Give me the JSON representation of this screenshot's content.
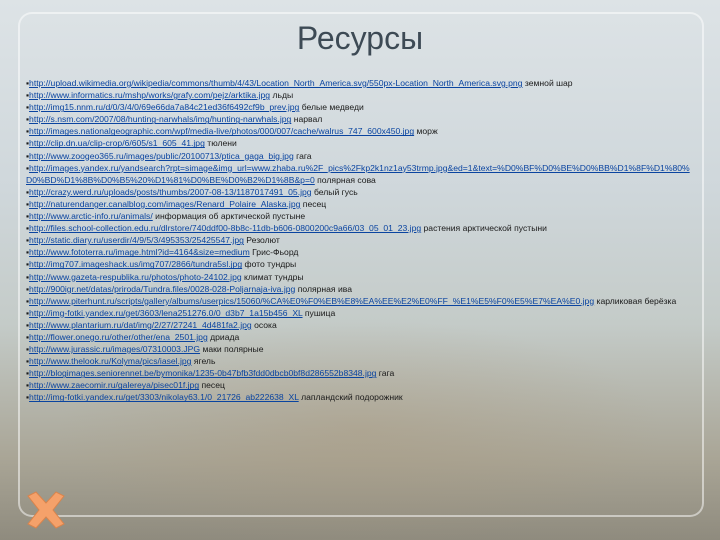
{
  "slide": {
    "title": "Ресурсы",
    "close_icon_color": "#f5a16a"
  },
  "items": [
    {
      "url": "http://upload.wikimedia.org/wikipedia/commons/thumb/4/43/Location_North_America.svg/550px-Location_North_America.svg.png",
      "text": " земной шар"
    },
    {
      "url": "http://www.informatics.ru/mshp/works/grafy.com/pejz/arktika.jpg",
      "text": " льды"
    },
    {
      "url": "http://img15.nnm.ru/d/0/3/4/0/69e66da7a84c21ed36f6492cf9b_prev.jpg",
      "text": "   белые медведи"
    },
    {
      "url": "http://s.nsm.com/2007/08/hunting-narwhals/img/hunting-narwhals.jpg",
      "text": "  нарвал"
    },
    {
      "url": "http://images.nationalgeographic.com/wpf/media-live/photos/000/007/cache/walrus_747_600x450.jpg",
      "text": " морж"
    },
    {
      "url": "http://clip.dn.ua/clip-crop/6/605/s1_605_41.jpg",
      "text": " тюлени"
    },
    {
      "url": "http://www.zoogeo365.ru/images/public/20100713/ptica_gaga_big.jpg",
      "text": " гага"
    },
    {
      "url": "http://images.yandex.ru/yandsearch?rpt=simage&img_url=www.zhaba.ru%2F_pics%2Fkp2k1nz1ay53trmp.jpg&ed=1&text=%D0%BF%D0%BE%D0%BB%D1%8F%D1%80%D0%BD%D1%8B%D0%B5%20%D1%81%D0%BE%D0%B2%D1%8B&p=0",
      "text": " полярная сова",
      "wrap": true
    },
    {
      "url": "http://crazy.werd.ru/uploads/posts/thumbs/2007-08-13/1187017491_05.jpg",
      "text": " белый гусь"
    },
    {
      "url": "http://naturendanger.canalblog.com/images/Renard_Polaire_Alaska.jpg",
      "text": " песец"
    },
    {
      "url": "http://www.arctic-info.ru/animals/",
      "text": " информация об арктической пустыне"
    },
    {
      "url": "http://files.school-collection.edu.ru/dlrstore/740ddf00-8b8c-11db-b606-0800200c9a66/03_05_01_23.jpg",
      "text": " растения арктической пустыни"
    },
    {
      "url": "http://static.diary.ru/userdir/4/9/5/3/495353/25425547.jpg",
      "text": " Резолют"
    },
    {
      "url": "http://www.fototerra.ru/image.html?id=4164&size=medium",
      "text": " Грис-Фьорд"
    },
    {
      "url": "http://img707.imageshack.us/img707/2866/tundra5sl.jpg",
      "text": " фото тундры"
    },
    {
      "url": "http://www.gazeta-respublika.ru/photos/photo-24102.jpg",
      "text": " климат тундры"
    },
    {
      "url": "http://900igr.net/datas/priroda/Tundra.files/0028-028-Poljarnaja-iva.jpg",
      "text": " полярная ива"
    },
    {
      "url": "http://www.piterhunt.ru/scripts/gallery/albums/userpics/15060/%CA%E0%F0%EB%E8%EA%EE%E2%E0%FF_%E1%E5%F0%E5%E7%EA%E0.jpg",
      "text": " карликовая берёзка",
      "wrap": true
    },
    {
      "url": "http://img-fotki.yandex.ru/get/3603/lena251276.0/0_d3b7_1a15b456_XL",
      "text": " пушица"
    },
    {
      "url": "http://www.plantarium.ru/dat/img/2/27/27241_4d481fa2.jpg",
      "text": " осока"
    },
    {
      "url": "http://flower.onego.ru/other/other/ena_2501.jpg",
      "text": " дриада"
    },
    {
      "url": "http://www.jurassic.ru/images/07310003.JPG",
      "text": " маки полярные"
    },
    {
      "url": "http://www.thelook.ru/Kolyma/pics/iasel.jpg",
      "text": " ягель"
    },
    {
      "url": "http://blogimages.seniorennet.be/bymonika/1235-0b47bfb3fdd0dbcb0bf8d286552b8348.jpg",
      "text": " гага"
    },
    {
      "url": "http://www.zaecomir.ru/galereya/pisec01f.jpg",
      "text": "    песец"
    },
    {
      "url": "http://img-fotki.yandex.ru/get/3303/nikolay63.1/0_21726_ab222638_XL",
      "text": " лапландский подорожник"
    }
  ]
}
